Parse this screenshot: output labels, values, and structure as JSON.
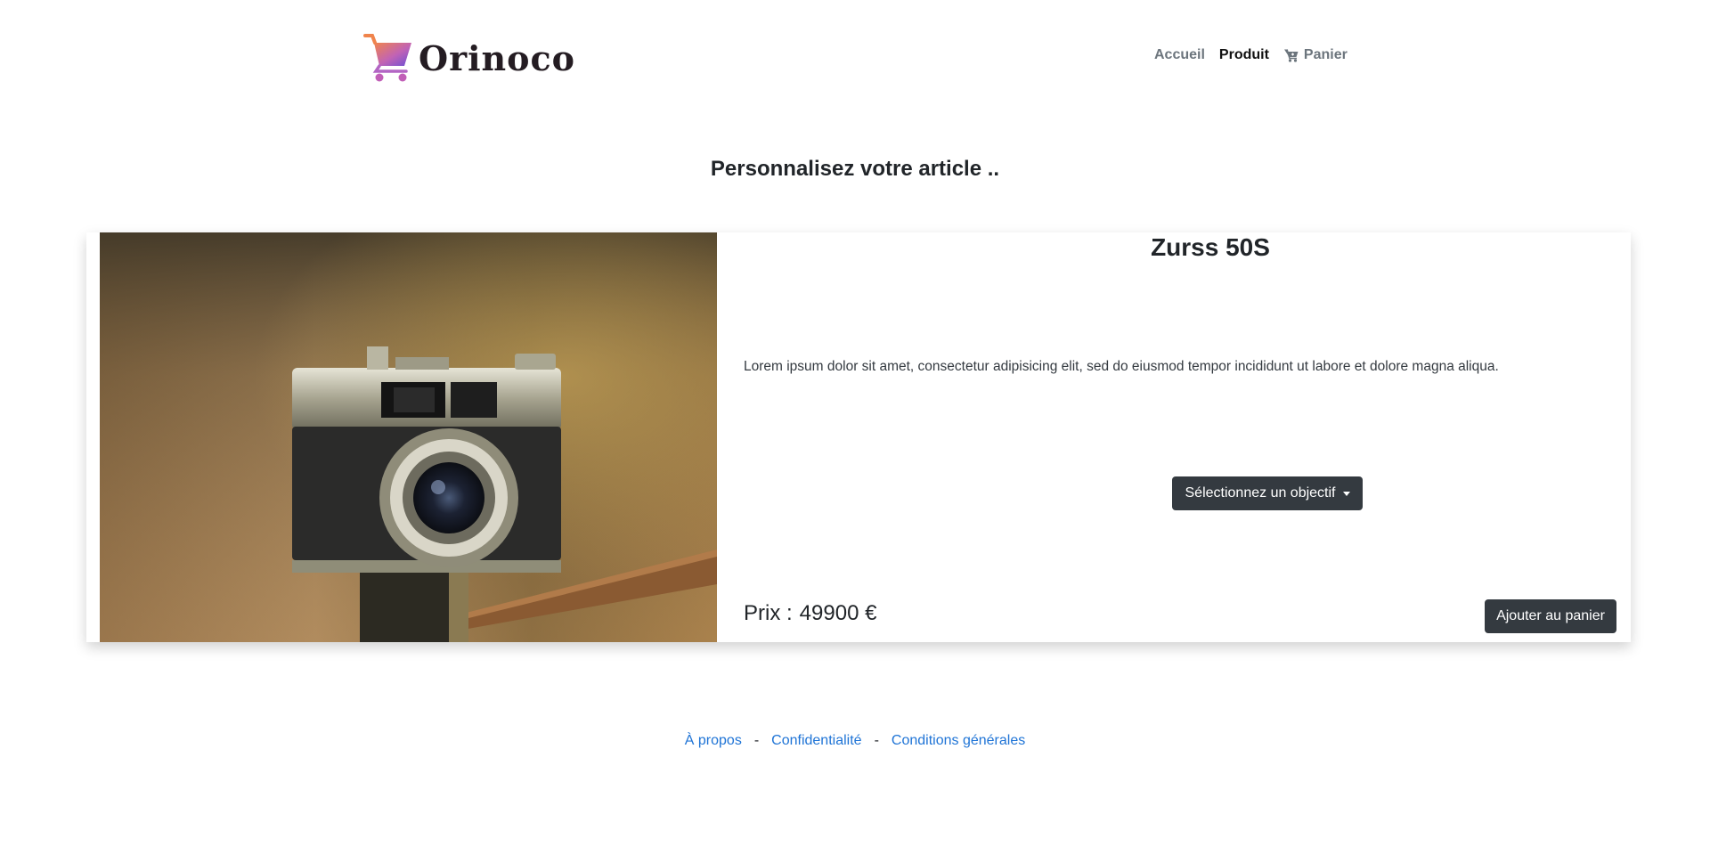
{
  "header": {
    "logo_text": "Orinoco",
    "nav": [
      {
        "label": "Accueil"
      },
      {
        "label": "Produit"
      },
      {
        "label": "Panier"
      }
    ]
  },
  "main": {
    "heading": "Personnalisez votre article ..",
    "product": {
      "name": "Zurss 50S",
      "description": "Lorem ipsum dolor sit amet, consectetur adipisicing elit, sed do eiusmod tempor incididunt ut labore et dolore magna aliqua.",
      "lens_select_label": "Sélectionnez un objectif",
      "price_label": "Prix :",
      "price_value": "49900 €",
      "add_to_cart_label": "Ajouter au panier"
    }
  },
  "footer": {
    "links": [
      {
        "label": "À propos"
      },
      {
        "label": "Confidentialité"
      },
      {
        "label": "Conditions générales"
      }
    ],
    "separator": "-"
  },
  "colors": {
    "dark_button": "#343a40",
    "link": "#1f74d6",
    "logo_gradient_start": "#f0844c",
    "logo_gradient_end": "#6a4fd6"
  }
}
